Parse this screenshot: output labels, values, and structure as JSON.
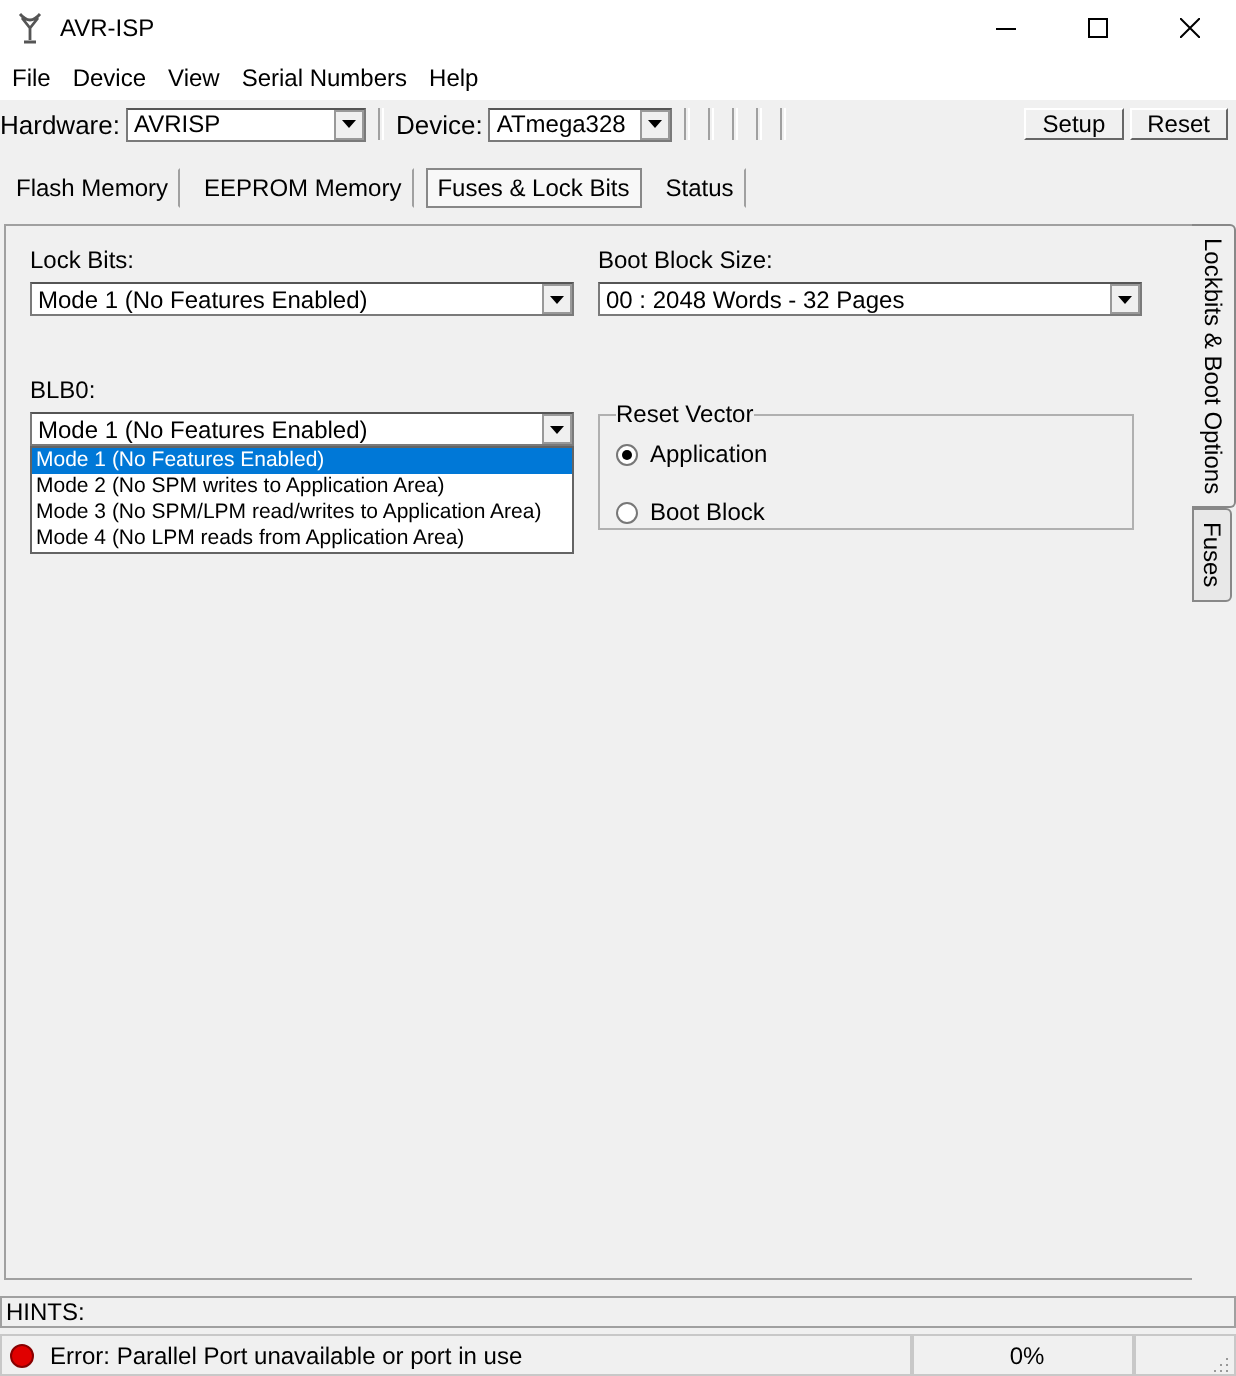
{
  "window": {
    "title": "AVR-ISP"
  },
  "menu": [
    "File",
    "Device",
    "View",
    "Serial Numbers",
    "Help"
  ],
  "toolbar": {
    "hardware_label": "Hardware:",
    "hardware": "AVRISP",
    "device_label": "Device:",
    "device": "ATmega328",
    "buttons": [
      "Setup",
      "Reset"
    ]
  },
  "tabs": [
    {
      "label": "Flash Memory",
      "selected": false
    },
    {
      "label": "EEPROM Memory",
      "selected": false
    },
    {
      "label": "Fuses & Lock Bits",
      "selected": true
    },
    {
      "label": "Status",
      "selected": false
    }
  ],
  "side_tabs": [
    {
      "label": "Lockbits & Boot Options",
      "selected": true
    },
    {
      "label": "Fuses",
      "selected": false
    }
  ],
  "lock_bits": {
    "label": "Lock Bits:",
    "value": "Mode 1 (No Features Enabled)"
  },
  "boot_block_size": {
    "label": "Boot Block Size:",
    "value": "00 : 2048 Words - 32 Pages"
  },
  "blb0": {
    "label": "BLB0:",
    "value": "Mode 1 (No Features Enabled)",
    "options": [
      {
        "label": "Mode 1 (No Features Enabled)",
        "selected": true
      },
      {
        "label": "Mode 2 (No SPM writes to Application Area)",
        "selected": false
      },
      {
        "label": "Mode 3 (No SPM/LPM read/writes to Application Area)",
        "selected": false
      },
      {
        "label": "Mode 4 (No LPM reads from Application Area)",
        "selected": false
      }
    ]
  },
  "reset_vector": {
    "title": "Reset Vector",
    "options": [
      {
        "label": "Application",
        "selected": true
      },
      {
        "label": "Boot Block",
        "selected": false
      }
    ]
  },
  "hints": {
    "label": "HINTS:"
  },
  "status_bar": {
    "message": "Error: Parallel Port unavailable or port in use",
    "progress": "0%"
  }
}
